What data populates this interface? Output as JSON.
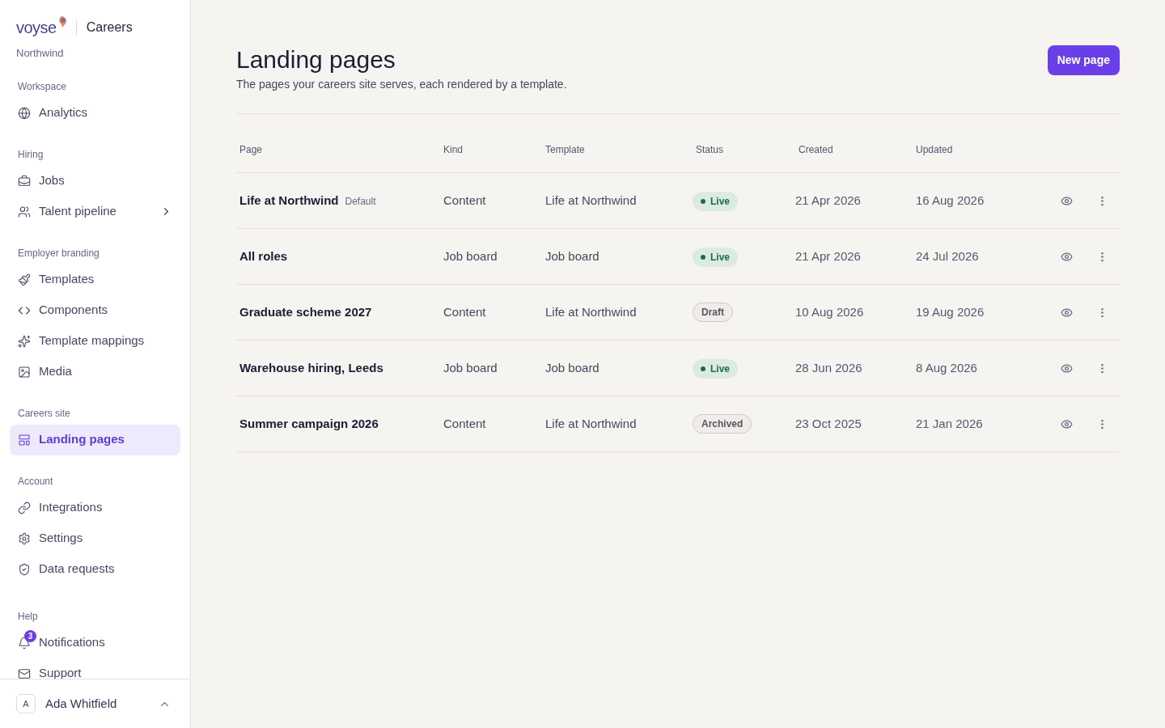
{
  "brand": {
    "logo": "voyse",
    "product": "Careers",
    "org": "Northwind"
  },
  "nav": [
    {
      "heading": "Workspace",
      "items": [
        {
          "label": "Analytics",
          "selected": false
        }
      ]
    },
    {
      "heading": "Hiring",
      "items": [
        {
          "label": "Jobs",
          "selected": false
        },
        {
          "label": "Talent pipeline",
          "selected": false,
          "expanded": false
        }
      ]
    },
    {
      "heading": "Employer branding",
      "items": [
        {
          "label": "Templates",
          "selected": false
        },
        {
          "label": "Components",
          "selected": false
        },
        {
          "label": "Template mappings",
          "selected": false
        },
        {
          "label": "Media",
          "selected": false
        }
      ]
    },
    {
      "heading": "Careers site",
      "items": [
        {
          "label": "Landing pages",
          "selected": true
        }
      ]
    },
    {
      "heading": "Account",
      "items": [
        {
          "label": "Integrations",
          "selected": false
        },
        {
          "label": "Settings",
          "selected": false
        },
        {
          "label": "Data requests",
          "selected": false
        }
      ]
    },
    {
      "heading": "Help",
      "items": [
        {
          "label": "Notifications",
          "selected": false,
          "badge": "3"
        },
        {
          "label": "Support",
          "selected": false
        }
      ]
    }
  ],
  "user": {
    "initial": "A",
    "name": "Ada Whitfield"
  },
  "header": {
    "title": "Landing pages",
    "subtitle": "The pages your careers site serves, each rendered by a template.",
    "button": "New page"
  },
  "table": {
    "columns": [
      "Page",
      "Kind",
      "Template",
      "Status",
      "Created",
      "Updated"
    ],
    "rows": [
      {
        "page": "Life at Northwind",
        "tag": "Default",
        "kind": "Content",
        "template": "Life at Northwind",
        "status": {
          "label": "Live",
          "kind": "live"
        },
        "created": "21 Apr 2026",
        "updated": "16 Aug 2026"
      },
      {
        "page": "All roles",
        "kind": "Job board",
        "template": "Job board",
        "status": {
          "label": "Live",
          "kind": "live"
        },
        "created": "21 Apr 2026",
        "updated": "24 Jul 2026"
      },
      {
        "page": "Graduate scheme 2027",
        "kind": "Content",
        "template": "Life at Northwind",
        "status": {
          "label": "Draft",
          "kind": "draft"
        },
        "created": "10 Aug 2026",
        "updated": "19 Aug 2026"
      },
      {
        "page": "Warehouse hiring, Leeds",
        "kind": "Job board",
        "template": "Job board",
        "status": {
          "label": "Live",
          "kind": "live"
        },
        "created": "28 Jun 2026",
        "updated": "8 Aug 2026"
      },
      {
        "page": "Summer campaign 2026",
        "kind": "Content",
        "template": "Life at Northwind",
        "status": {
          "label": "Archived",
          "kind": "archived"
        },
        "created": "23 Oct 2025",
        "updated": "21 Jan 2026"
      }
    ]
  }
}
